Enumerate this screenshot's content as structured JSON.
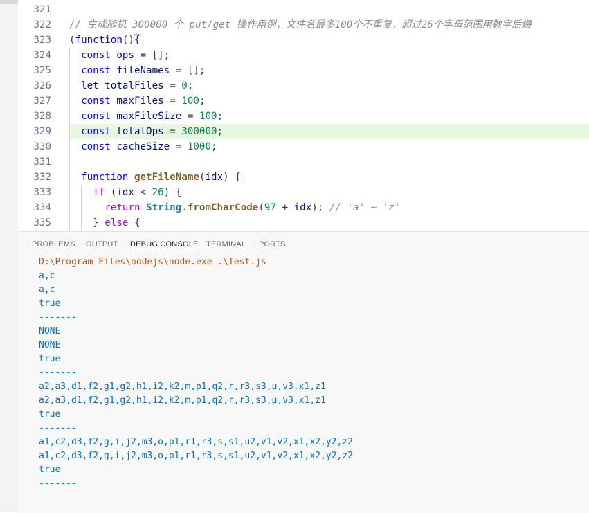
{
  "editor": {
    "lines": [
      {
        "num": "321",
        "tokens": []
      },
      {
        "num": "322",
        "tokens": [
          {
            "t": "// 生成随机 300000 个 put/get 操作用例，文件名最多100个不重复，超过26个字母范围用数字后缀",
            "c": "cmt"
          }
        ]
      },
      {
        "num": "323",
        "tokens": [
          {
            "t": "(",
            "c": "op"
          },
          {
            "t": "function",
            "c": "kw"
          },
          {
            "t": "()",
            "c": "op"
          },
          {
            "t": "{",
            "c": "bracket-gold bracket-box"
          }
        ]
      },
      {
        "num": "324",
        "tokens": [
          {
            "t": "  const ",
            "c": "kw"
          },
          {
            "t": "ops",
            "c": "var"
          },
          {
            "t": " = [];",
            "c": "op"
          }
        ]
      },
      {
        "num": "325",
        "tokens": [
          {
            "t": "  const ",
            "c": "kw"
          },
          {
            "t": "fileNames",
            "c": "var"
          },
          {
            "t": " = [];",
            "c": "op"
          }
        ]
      },
      {
        "num": "326",
        "tokens": [
          {
            "t": "  let ",
            "c": "kw"
          },
          {
            "t": "totalFiles",
            "c": "var"
          },
          {
            "t": " = ",
            "c": "op"
          },
          {
            "t": "0",
            "c": "num"
          },
          {
            "t": ";",
            "c": "op"
          }
        ]
      },
      {
        "num": "327",
        "tokens": [
          {
            "t": "  const ",
            "c": "kw"
          },
          {
            "t": "maxFiles",
            "c": "var"
          },
          {
            "t": " = ",
            "c": "op"
          },
          {
            "t": "100",
            "c": "num"
          },
          {
            "t": ";",
            "c": "op"
          }
        ]
      },
      {
        "num": "328",
        "tokens": [
          {
            "t": "  const ",
            "c": "kw"
          },
          {
            "t": "maxFileSize",
            "c": "var"
          },
          {
            "t": " = ",
            "c": "op"
          },
          {
            "t": "100",
            "c": "num"
          },
          {
            "t": ";",
            "c": "op"
          }
        ]
      },
      {
        "num": "329",
        "active": true,
        "tokens": [
          {
            "t": "  const ",
            "c": "kw"
          },
          {
            "t": "totalOps",
            "c": "var"
          },
          {
            "t": " = ",
            "c": "op"
          },
          {
            "t": "300000",
            "c": "num"
          },
          {
            "t": ";",
            "c": "op"
          }
        ]
      },
      {
        "num": "330",
        "tokens": [
          {
            "t": "  const ",
            "c": "kw"
          },
          {
            "t": "cacheSize",
            "c": "var"
          },
          {
            "t": " = ",
            "c": "op"
          },
          {
            "t": "1000",
            "c": "num"
          },
          {
            "t": ";",
            "c": "op"
          }
        ]
      },
      {
        "num": "331",
        "tokens": []
      },
      {
        "num": "332",
        "tokens": [
          {
            "t": "  function ",
            "c": "kw"
          },
          {
            "t": "getFileName",
            "c": "fn"
          },
          {
            "t": "(",
            "c": "op"
          },
          {
            "t": "idx",
            "c": "var"
          },
          {
            "t": ") {",
            "c": "op"
          }
        ]
      },
      {
        "num": "333",
        "tokens": [
          {
            "t": "    if ",
            "c": "kw2"
          },
          {
            "t": "(",
            "c": "op"
          },
          {
            "t": "idx",
            "c": "var"
          },
          {
            "t": " < ",
            "c": "op"
          },
          {
            "t": "26",
            "c": "num"
          },
          {
            "t": ") {",
            "c": "op"
          }
        ]
      },
      {
        "num": "334",
        "tokens": [
          {
            "t": "      return ",
            "c": "kw2"
          },
          {
            "t": "String",
            "c": "cls"
          },
          {
            "t": ".",
            "c": "op"
          },
          {
            "t": "fromCharCode",
            "c": "fn"
          },
          {
            "t": "(",
            "c": "op"
          },
          {
            "t": "97",
            "c": "num"
          },
          {
            "t": " + ",
            "c": "op"
          },
          {
            "t": "idx",
            "c": "var"
          },
          {
            "t": "); ",
            "c": "op"
          },
          {
            "t": "// 'a' ~ 'z'",
            "c": "cmt"
          }
        ]
      },
      {
        "num": "335",
        "tokens": [
          {
            "t": "    } ",
            "c": "op"
          },
          {
            "t": "else",
            "c": "kw2"
          },
          {
            "t": " {",
            "c": "op"
          }
        ]
      }
    ]
  },
  "panel": {
    "tabs": [
      {
        "label": "PROBLEMS",
        "active": false
      },
      {
        "label": "OUTPUT",
        "active": false
      },
      {
        "label": "DEBUG CONSOLE",
        "active": true
      },
      {
        "label": "TERMINAL",
        "active": false
      },
      {
        "label": "PORTS",
        "active": false
      }
    ],
    "console": [
      {
        "text": "D:\\Program Files\\nodejs\\node.exe .\\Test.js",
        "path": true
      },
      {
        "text": "a,c"
      },
      {
        "text": "a,c"
      },
      {
        "text": "true"
      },
      {
        "text": "-------"
      },
      {
        "text": "NONE"
      },
      {
        "text": "NONE"
      },
      {
        "text": "true"
      },
      {
        "text": "-------"
      },
      {
        "text": "a2,a3,d1,f2,g1,g2,h1,i2,k2,m,p1,q2,r,r3,s3,u,v3,x1,z1"
      },
      {
        "text": "a2,a3,d1,f2,g1,g2,h1,i2,k2,m,p1,q2,r,r3,s3,u,v3,x1,z1"
      },
      {
        "text": "true"
      },
      {
        "text": "-------"
      },
      {
        "text": "a1,c2,d3,f2,g,i,j2,m3,o,p1,r1,r3,s,s1,u2,v1,v2,x1,x2,y2,z2"
      },
      {
        "text": "a1,c2,d3,f2,g,i,j2,m3,o,p1,r1,r3,s,s1,u2,v1,v2,x1,x2,y2,z2"
      },
      {
        "text": "true"
      },
      {
        "text": "-------"
      }
    ]
  },
  "colors": {
    "active_line_bg": "#e8f7e0",
    "console_text": "#0070c1",
    "console_path": "#b5531a"
  }
}
